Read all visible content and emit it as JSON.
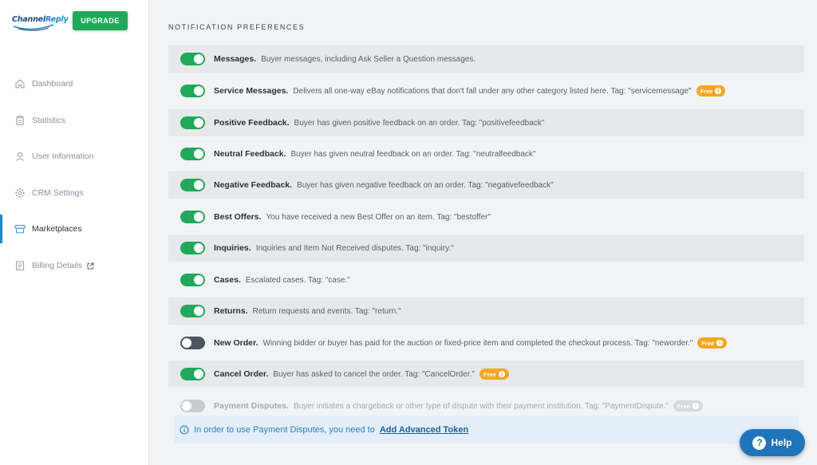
{
  "brand": {
    "logo_part1": "Channel",
    "logo_part2": "Reply",
    "upgrade_label": "UPGRADE",
    "accent": "#22a85a",
    "link_color": "#1e8ac8"
  },
  "sidebar": {
    "items": [
      {
        "label": "Dashboard",
        "icon": "home-icon"
      },
      {
        "label": "Statistics",
        "icon": "clipboard-icon"
      },
      {
        "label": "User Information",
        "icon": "user-icon"
      },
      {
        "label": "CRM Settings",
        "icon": "gear-icon"
      },
      {
        "label": "Marketplaces",
        "icon": "store-icon",
        "active": true
      },
      {
        "label": "Billing Details",
        "icon": "receipt-icon",
        "external": true
      }
    ]
  },
  "section_title": "NOTIFICATION PREFERENCES",
  "notifications": [
    {
      "name": "Messages.",
      "desc": "Buyer messages, including Ask Seller a Question messages.",
      "state": "on"
    },
    {
      "name": "Service Messages.",
      "desc": "Delivers all one-way eBay notifications that don't fall under any other category listed here. Tag: \"servicemessage\"",
      "state": "on",
      "badge": "Free"
    },
    {
      "name": "Positive Feedback.",
      "desc": "Buyer has given positive feedback on an order. Tag: \"positivefeedback\"",
      "state": "on"
    },
    {
      "name": "Neutral Feedback.",
      "desc": "Buyer has given neutral feedback on an order. Tag: \"neutralfeedback\"",
      "state": "on"
    },
    {
      "name": "Negative Feedback.",
      "desc": "Buyer has given negative feedback on an order. Tag: \"negativefeedback\"",
      "state": "on"
    },
    {
      "name": "Best Offers.",
      "desc": "You have received a new Best Offer on an item. Tag: \"bestoffer\"",
      "state": "on"
    },
    {
      "name": "Inquiries.",
      "desc": "Inquiries and Item Not Received disputes. Tag: \"inquiry.\"",
      "state": "on"
    },
    {
      "name": "Cases.",
      "desc": "Escalated cases. Tag: \"case.\"",
      "state": "on"
    },
    {
      "name": "Returns.",
      "desc": "Return requests and events. Tag: \"return.\"",
      "state": "on"
    },
    {
      "name": "New Order.",
      "desc": "Winning bidder or buyer has paid for the auction or fixed-price item and completed the checkout process. Tag: \"neworder.\"",
      "state": "off",
      "badge": "Free"
    },
    {
      "name": "Cancel Order.",
      "desc": "Buyer has asked to cancel the order. Tag: \"CancelOrder.\"",
      "state": "on",
      "badge": "Free"
    },
    {
      "name": "Payment Disputes.",
      "desc": "Buyer initiates a chargeback or other type of dispute with their payment institution. Tag: \"PaymentDispute.\"",
      "state": "disabled",
      "badge": "Free"
    }
  ],
  "info": {
    "text": "In order to use Payment Disputes, you need to",
    "link": "Add Advanced Token"
  },
  "help": {
    "label": "Help"
  }
}
